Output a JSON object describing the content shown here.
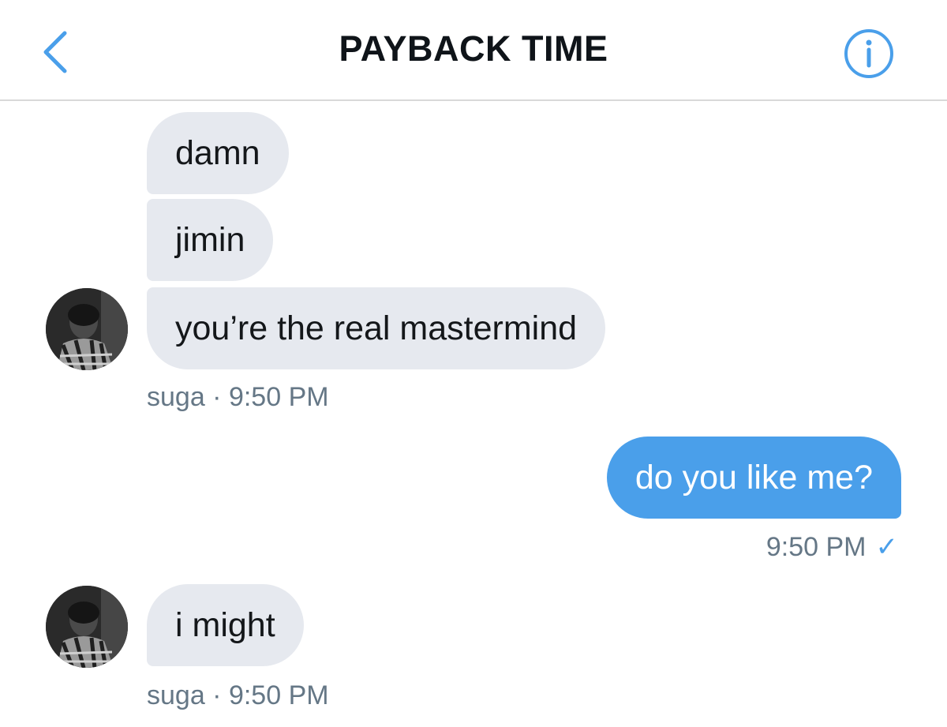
{
  "header": {
    "title": "PAYBACK TIME",
    "back_icon": "chevron-left-icon",
    "info_icon": "info-icon",
    "accent_color": "#4a9fea"
  },
  "messages": [
    {
      "sender": "received",
      "text": "damn"
    },
    {
      "sender": "received",
      "text": "jimin"
    },
    {
      "sender": "received",
      "text": "you’re the real mastermind"
    },
    {
      "sender": "sent",
      "text": "do you like me?"
    },
    {
      "sender": "received",
      "text": "i might"
    }
  ],
  "meta": {
    "group1": "suga · 9:50 PM",
    "sent": "9:50 PM",
    "sent_status_icon": "checkmark-icon",
    "group2": "suga · 9:50 PM"
  },
  "colors": {
    "received_bubble": "#e6e9ef",
    "sent_bubble": "#4a9fea",
    "meta_text": "#657786"
  }
}
